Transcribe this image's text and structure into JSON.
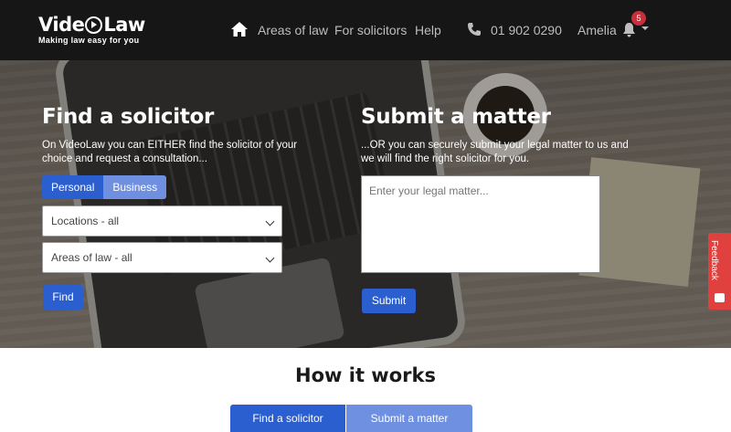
{
  "header": {
    "logo_text": "VideoLaw",
    "logo_tagline": "Making law easy for you",
    "nav": [
      "Areas of law",
      "For solicitors",
      "Help"
    ],
    "phone": "01 902 0290",
    "user": "Amelia",
    "notification_count": "5"
  },
  "find": {
    "title": "Find a solicitor",
    "description": "On VideoLaw you can EITHER find the solicitor of your choice and request a consultation...",
    "tabs": [
      "Personal",
      "Business"
    ],
    "location_select": "Locations - all",
    "area_select": "Areas of law - all",
    "button": "Find"
  },
  "submit": {
    "title": "Submit a matter",
    "description": "...OR you can securely submit your legal matter to us and we will find the right solicitor for you.",
    "placeholder": "Enter your legal matter...",
    "button": "Submit"
  },
  "feedback_label": "Feedback",
  "how": {
    "title": "How it works",
    "tabs": [
      "Find a solicitor",
      "Submit a matter"
    ]
  },
  "colors": {
    "header_bg": "#161616",
    "primary": "#2b5fd0",
    "primary_light": "#6f8fe0",
    "feedback": "#e0413f",
    "badge": "#c7303a"
  },
  "icons": [
    "home-icon",
    "phone-icon",
    "bell-icon",
    "chevron-down-icon",
    "feedback-icon"
  ]
}
